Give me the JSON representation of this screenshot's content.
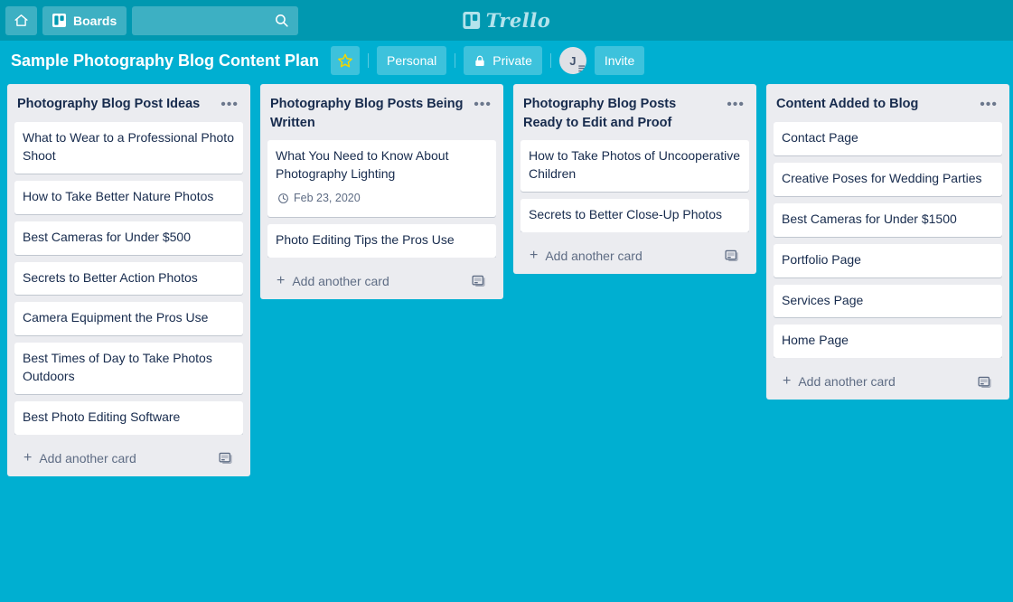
{
  "top_nav": {
    "home_icon": "home-icon",
    "boards_icon": "boards-grid-icon",
    "boards_label": "Boards",
    "search_value": "",
    "search_placeholder": "",
    "search_icon": "search-icon",
    "logo_text": "Trello",
    "logo_icon": "trello-board-icon"
  },
  "board_header": {
    "title": "Sample Photography Blog Content Plan",
    "star_icon": "star-icon",
    "visibility_team": "Personal",
    "visibility_label": "Private",
    "lock_icon": "lock-icon",
    "avatar_initial": "J",
    "invite_label": "Invite"
  },
  "colors": {
    "board_background": "#00AFD1",
    "top_nav_background": "#0098B0",
    "list_background": "#EBECF0",
    "card_background": "#FFFFFF",
    "text_primary": "#172B4D",
    "text_subtle": "#5E6C84",
    "star_gold": "#F2D600"
  },
  "lists": [
    {
      "title": "Photography Blog Post Ideas",
      "menu_icon": "list-menu-dots-icon",
      "add_card_label": "Add another card",
      "template_icon": "card-template-icon",
      "cards": [
        {
          "title": "What to Wear to a Professional Photo Shoot"
        },
        {
          "title": "How to Take Better Nature Photos"
        },
        {
          "title": "Best Cameras for Under $500"
        },
        {
          "title": "Secrets to Better Action Photos"
        },
        {
          "title": "Camera Equipment the Pros Use"
        },
        {
          "title": "Best Times of Day to Take Photos Outdoors"
        },
        {
          "title": "Best Photo Editing Software"
        }
      ]
    },
    {
      "title": "Photography Blog Posts Being Written",
      "menu_icon": "list-menu-dots-icon",
      "add_card_label": "Add another card",
      "template_icon": "card-template-icon",
      "cards": [
        {
          "title": "What You Need to Know About Photography Lighting",
          "due_date": "Feb 23, 2020",
          "due_icon": "clock-icon"
        },
        {
          "title": "Photo Editing Tips the Pros Use"
        }
      ]
    },
    {
      "title": "Photography Blog Posts Ready to Edit and Proof",
      "menu_icon": "list-menu-dots-icon",
      "add_card_label": "Add another card",
      "template_icon": "card-template-icon",
      "cards": [
        {
          "title": "How to Take Photos of Uncooperative Children"
        },
        {
          "title": "Secrets to Better Close-Up Photos"
        }
      ]
    },
    {
      "title": "Content Added to Blog",
      "menu_icon": "list-menu-dots-icon",
      "add_card_label": "Add another card",
      "template_icon": "card-template-icon",
      "cards": [
        {
          "title": "Contact Page"
        },
        {
          "title": "Creative Poses for Wedding Parties"
        },
        {
          "title": "Best Cameras for Under $1500"
        },
        {
          "title": "Portfolio Page"
        },
        {
          "title": "Services Page"
        },
        {
          "title": "Home Page"
        }
      ]
    }
  ]
}
